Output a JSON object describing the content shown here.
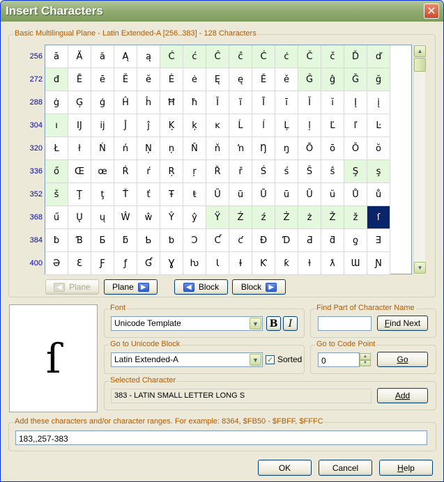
{
  "window": {
    "title": "Insert Characters",
    "close_label": "✕"
  },
  "grid_group": {
    "label": "Basic Multilingual Plane - Latin Extended-A [256..383] - 128 Characters",
    "row_labels": [
      "256",
      "272",
      "288",
      "304",
      "320",
      "336",
      "352",
      "368",
      "384",
      "400"
    ],
    "rows": [
      [
        "ā",
        "Ă",
        "ă",
        "Ą",
        "ą",
        "Ć",
        "ć",
        "Ĉ",
        "ĉ",
        "Ċ",
        "ċ",
        "Č",
        "č",
        "Ď",
        "ď"
      ],
      [
        "đ",
        "Ē",
        "ē",
        "Ĕ",
        "ĕ",
        "Ė",
        "ė",
        "Ę",
        "ę",
        "Ě",
        "ě",
        "Ĝ",
        "ĝ",
        "Ğ",
        "ğ"
      ],
      [
        "ġ",
        "Ģ",
        "ģ",
        "Ĥ",
        "ĥ",
        "Ħ",
        "ħ",
        "Ĩ",
        "ĩ",
        "Ī",
        "ī",
        "Ĭ",
        "ĭ",
        "Į",
        "į"
      ],
      [
        "ı",
        "Ĳ",
        "ĳ",
        "Ĵ",
        "ĵ",
        "Ķ",
        "ķ",
        "ĸ",
        "Ĺ",
        "ĺ",
        "Ļ",
        "ļ",
        "Ľ",
        "ľ",
        "Ŀ"
      ],
      [
        "Ł",
        "ł",
        "Ń",
        "ń",
        "Ņ",
        "ņ",
        "Ň",
        "ň",
        "ŉ",
        "Ŋ",
        "ŋ",
        "Ō",
        "ō",
        "Ŏ",
        "ŏ"
      ],
      [
        "ő",
        "Œ",
        "œ",
        "Ŕ",
        "ŕ",
        "Ŗ",
        "ŗ",
        "Ř",
        "ř",
        "Ś",
        "ś",
        "Ŝ",
        "ŝ",
        "Ş",
        "ş"
      ],
      [
        "š",
        "Ţ",
        "ţ",
        "Ť",
        "ť",
        "Ŧ",
        "ŧ",
        "Ũ",
        "ũ",
        "Ū",
        "ū",
        "Ŭ",
        "ŭ",
        "Ů",
        "ů"
      ],
      [
        "ű",
        "Ų",
        "ų",
        "Ŵ",
        "ŵ",
        "Ŷ",
        "ŷ",
        "Ÿ",
        "Ź",
        "ź",
        "Ż",
        "ż",
        "Ž",
        "ž",
        "ſ"
      ],
      [
        "ƀ",
        "Ɓ",
        "Ƃ",
        "ƃ",
        "Ƅ",
        "ƅ",
        "Ɔ",
        "Ƈ",
        "ƈ",
        "Ɖ",
        "Ɗ",
        "Ƌ",
        "ƌ",
        "ƍ",
        "Ǝ"
      ],
      [
        "Ə",
        "Ɛ",
        "Ƒ",
        "ƒ",
        "Ɠ",
        "Ɣ",
        "ƕ",
        "Ɩ",
        "Ɨ",
        "Ƙ",
        "ƙ",
        "ƚ",
        "ƛ",
        "Ɯ",
        "Ɲ"
      ]
    ],
    "highlight_rows": [
      [
        5,
        6,
        7,
        8,
        9,
        10,
        11,
        12,
        13,
        14
      ],
      [
        0,
        11,
        12,
        13,
        14
      ],
      [],
      [
        0
      ],
      [],
      [
        0,
        13,
        14
      ],
      [
        0
      ],
      [
        7,
        8,
        9,
        10,
        11,
        12,
        13
      ],
      [],
      []
    ],
    "selected_cell": {
      "row": 7,
      "col": 14
    },
    "nav_buttons": {
      "prev_plane": "Plane",
      "next_plane": "Plane",
      "prev_block": "Block",
      "next_block": "Block"
    }
  },
  "preview": {
    "character": "ſ"
  },
  "font_group": {
    "label": "Font",
    "value": "Unicode Template",
    "bold_label": "B",
    "italic_label": "I"
  },
  "find_group": {
    "label": "Find Part of Character Name",
    "input_value": "",
    "button_label": "Find Next"
  },
  "block_group": {
    "label": "Go to Unicode Block",
    "value": "Latin Extended-A",
    "sorted_label": "Sorted",
    "sorted_checked": true
  },
  "codepoint_group": {
    "label": "Go to Code Point",
    "value": "0",
    "button_label": "Go"
  },
  "selected_group": {
    "label": "Selected Character",
    "value": "383 - LATIN SMALL LETTER LONG S",
    "button_label": "Add"
  },
  "ranges_group": {
    "label": "Add these characters and/or character ranges. For example: 8364, $FB50 - $FBFF, $FFFC",
    "value": "183,,257-383"
  },
  "footer": {
    "ok": "OK",
    "cancel": "Cancel",
    "help": "Help"
  }
}
